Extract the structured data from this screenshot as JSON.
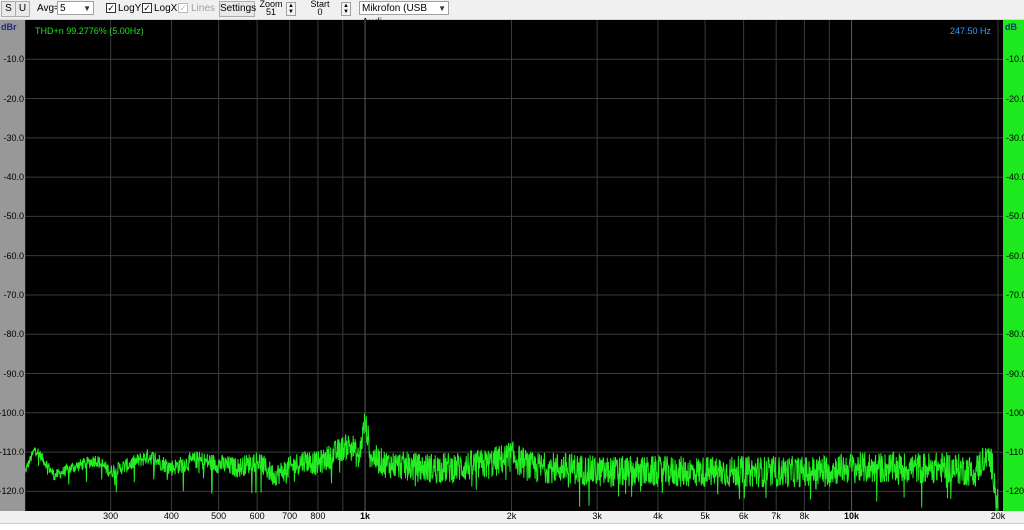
{
  "toolbar": {
    "s_label": "S",
    "u_label": "U",
    "avg_label": "Avg=",
    "avg_value": "5",
    "logy_label": "LogY",
    "logy_checked": true,
    "logx_label": "LogX",
    "logx_checked": true,
    "lines_label": "Lines",
    "lines_checked": true,
    "settings_label": "Settings",
    "zoom_label": "Zoom",
    "zoom_value": "51",
    "start_label": "Start",
    "start_value": "0",
    "device_value": "Mikrofon (USB Audi"
  },
  "left_axis_unit": "dBr",
  "right_axis_unit": "dB",
  "plot": {
    "thd_text": "THD+n 99.2776% (5.00Hz)",
    "freq_readout": "247.50 Hz"
  },
  "colors": {
    "trace": "#22ee22",
    "thd_text": "#22dd22",
    "freq_readout": "#3399ff",
    "grid": "#3a3a3a",
    "right_axis_bg": "#1ee81e"
  },
  "chart_data": {
    "type": "line",
    "title": "",
    "xlabel": "",
    "ylabel": "",
    "x_scale": "log",
    "xlim": [
      200,
      20000
    ],
    "ylim": [
      -125,
      0
    ],
    "grid": true,
    "x_ticks": [
      {
        "value": 300,
        "label": "300"
      },
      {
        "value": 400,
        "label": "400"
      },
      {
        "value": 500,
        "label": "500"
      },
      {
        "value": 600,
        "label": "600"
      },
      {
        "value": 700,
        "label": "700"
      },
      {
        "value": 800,
        "label": "800"
      },
      {
        "value": 1000,
        "label": "1k",
        "major": true
      },
      {
        "value": 2000,
        "label": "2k"
      },
      {
        "value": 3000,
        "label": "3k"
      },
      {
        "value": 4000,
        "label": "4k"
      },
      {
        "value": 5000,
        "label": "5k"
      },
      {
        "value": 6000,
        "label": "6k"
      },
      {
        "value": 7000,
        "label": "7k"
      },
      {
        "value": 8000,
        "label": "8k"
      },
      {
        "value": 10000,
        "label": "10k",
        "major": true
      },
      {
        "value": 20000,
        "label": "20k"
      }
    ],
    "y_ticks": [
      {
        "value": -10,
        "label": "-10.0",
        "right_label": "-10.0"
      },
      {
        "value": -20,
        "label": "-20.0",
        "right_label": "-20.0"
      },
      {
        "value": -30,
        "label": "-30.0",
        "right_label": "-30.0"
      },
      {
        "value": -40,
        "label": "-40.0",
        "right_label": "-40.0"
      },
      {
        "value": -50,
        "label": "-50.0",
        "right_label": "-50.0"
      },
      {
        "value": -60,
        "label": "-60.0",
        "right_label": "-60.0"
      },
      {
        "value": -70,
        "label": "-70.0",
        "right_label": "-70.0"
      },
      {
        "value": -80,
        "label": "-80.0",
        "right_label": "-80.0"
      },
      {
        "value": -90,
        "label": "-90.0",
        "right_label": "-90.0"
      },
      {
        "value": -100,
        "label": "-100.0",
        "right_label": "-100"
      },
      {
        "value": -110,
        "label": "-110.0",
        "right_label": "-110"
      },
      {
        "value": -120,
        "label": "-120.0",
        "right_label": "-120"
      }
    ],
    "series": [
      {
        "noise_floor_db": -115,
        "noise_band_db": [
          -118,
          -111
        ],
        "spectrum_points": [
          [
            200,
            -115
          ],
          [
            210,
            -109
          ],
          [
            230,
            -116
          ],
          [
            250,
            -114
          ],
          [
            280,
            -112
          ],
          [
            300,
            -115
          ],
          [
            330,
            -113
          ],
          [
            360,
            -111
          ],
          [
            400,
            -114
          ],
          [
            450,
            -112
          ],
          [
            500,
            -113
          ],
          [
            550,
            -114
          ],
          [
            600,
            -112
          ],
          [
            650,
            -116
          ],
          [
            700,
            -114
          ],
          [
            750,
            -112
          ],
          [
            800,
            -113
          ],
          [
            850,
            -111
          ],
          [
            900,
            -109
          ],
          [
            940,
            -108
          ],
          [
            970,
            -112
          ],
          [
            1000,
            -102
          ],
          [
            1030,
            -111
          ],
          [
            1100,
            -113
          ],
          [
            1300,
            -114
          ],
          [
            1500,
            -114
          ],
          [
            1800,
            -113
          ],
          [
            2000,
            -111
          ],
          [
            2200,
            -114
          ],
          [
            2600,
            -114
          ],
          [
            3000,
            -115
          ],
          [
            4000,
            -115
          ],
          [
            5000,
            -115
          ],
          [
            6000,
            -115
          ],
          [
            8000,
            -115
          ],
          [
            10000,
            -114
          ],
          [
            13000,
            -114
          ],
          [
            16000,
            -114
          ],
          [
            18000,
            -115
          ],
          [
            19000,
            -110
          ],
          [
            19500,
            -114
          ],
          [
            20000,
            -124
          ]
        ],
        "spikes": [
          {
            "x": 1000,
            "y": -102
          },
          {
            "x": 19000,
            "y": -110
          }
        ]
      }
    ]
  }
}
